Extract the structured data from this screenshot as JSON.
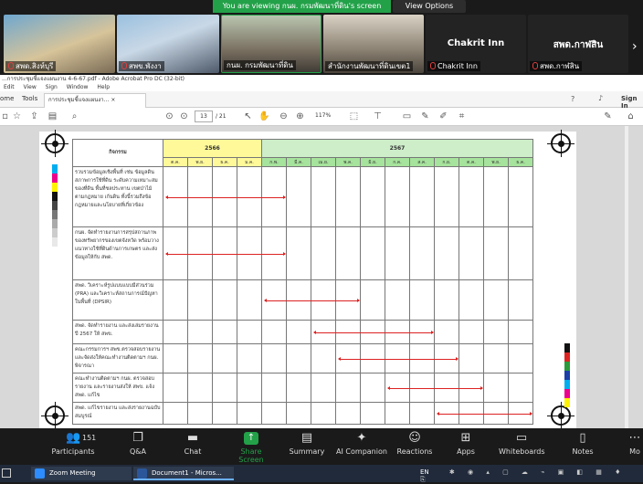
{
  "banner": {
    "message": "You are viewing กนผ. กรมพัฒนาที่ดิน's screen",
    "view_options": "View Options"
  },
  "participants": [
    {
      "name": "สพด.สิงห์บุรี"
    },
    {
      "name": "สพข.พังงา"
    },
    {
      "name": "กนผ. กรมพัฒนาที่ดิน"
    },
    {
      "name": "สำนักงานพัฒนาที่ดินเขต1"
    },
    {
      "name": "Chakrit Inn",
      "label": "Chakrit Inn"
    },
    {
      "name": "สพด.กาฬสิน",
      "label": "สพด.กาฬสิน"
    }
  ],
  "acrobat": {
    "title": "...การประชุมชี้แจงแผนงาน 4-6-67.pdf - Adobe Acrobat Pro DC (32-bit)",
    "menu": [
      "Edit",
      "View",
      "Sign",
      "Window",
      "Help"
    ],
    "tabs": {
      "home": "ome",
      "tools": "Tools",
      "doc": "การประชุมชี้แจงแผนงา...",
      "sign_in": "Sign In"
    },
    "page_current": "13",
    "page_total": "/ 21",
    "zoom": "117%"
  },
  "table": {
    "activity_header": "กิจกรรม",
    "year1": "2566",
    "year2": "2567",
    "months66": [
      "ต.ค.",
      "พ.ย.",
      "ธ.ค.",
      "ม.ค."
    ],
    "months67": [
      "ก.พ.",
      "มี.ค.",
      "เม.ย.",
      "พ.ค.",
      "มิ.ย.",
      "ก.ค.",
      "ส.ค.",
      "ก.ย.",
      "ต.ค.",
      "พ.ย.",
      "ธ.ค."
    ],
    "rows": [
      {
        "text": "รวบรวมข้อมูลเชิงพื้นที่ เช่น ข้อมูลดิน สภาพการใช้ที่ดิน ระดับความเหมาะสมของที่ดิน พื้นที่ชลประทาน เขตป่าไม้ตามกฎหมาย เก้นดิน ทั้งนี้รวมถึงข้อกฎหมายและนโยบายที่เกี่ยวข้อง",
        "start": 1,
        "end": 5
      },
      {
        "text": "กนผ. จัดทำรายงานการสรุปสถานภาพของทรัพยากรของเขตจังหวัด พร้อมวางแนวทางใช้ที่ดินด้านการเกษตร และส่งข้อมูลให้กับ สพด.",
        "start": 1,
        "end": 5
      },
      {
        "text": "สพด. วิเคราะห์รูปแบบแบบมีส่วนร่วม (PRA) และวิเคราะห์สถานการณ์ปัญหาในพื้นที่ (DPSIR)",
        "start": 5,
        "end": 8
      },
      {
        "text": "สพด. จัดทำรายงาน และส่งเล่มรายงานปี 2567 ให้ สพข.",
        "start": 7,
        "end": 11
      },
      {
        "text": "คณะกรรมการฯ สพข.ตรวจสอบรายงานและจัดส่งให้คณะทำงานติดตามฯ กนผ. พิจารณา",
        "start": 8,
        "end": 12
      },
      {
        "text": "คณะทำงานติดตามฯ กนผ. ตรวจสอบรายงาน และรายงานส่งให้ สพข. แจ้ง สพด. แก้ไข",
        "start": 10,
        "end": 13
      },
      {
        "text": "สพด. แก้ไขรายงาน และส่งรายงานฉบับสมบูรณ์",
        "start": 12,
        "end": 15
      }
    ]
  },
  "zoom_toolbar": {
    "participants_count": "151",
    "items": [
      "Participants",
      "Q&A",
      "Chat",
      "Share Screen",
      "Summary",
      "AI Companion",
      "Reactions",
      "Apps",
      "Whiteboards",
      "Notes",
      "Mo"
    ]
  },
  "taskbar": {
    "zoom_meeting": "Zoom Meeting",
    "document": "Document1 - Micros...",
    "lang": "EN"
  },
  "colors": {
    "share_green": "#23a149",
    "arrow_red": "#d22222",
    "year66_yellow": "#fff99a",
    "year67_green": "#cdeec9"
  }
}
